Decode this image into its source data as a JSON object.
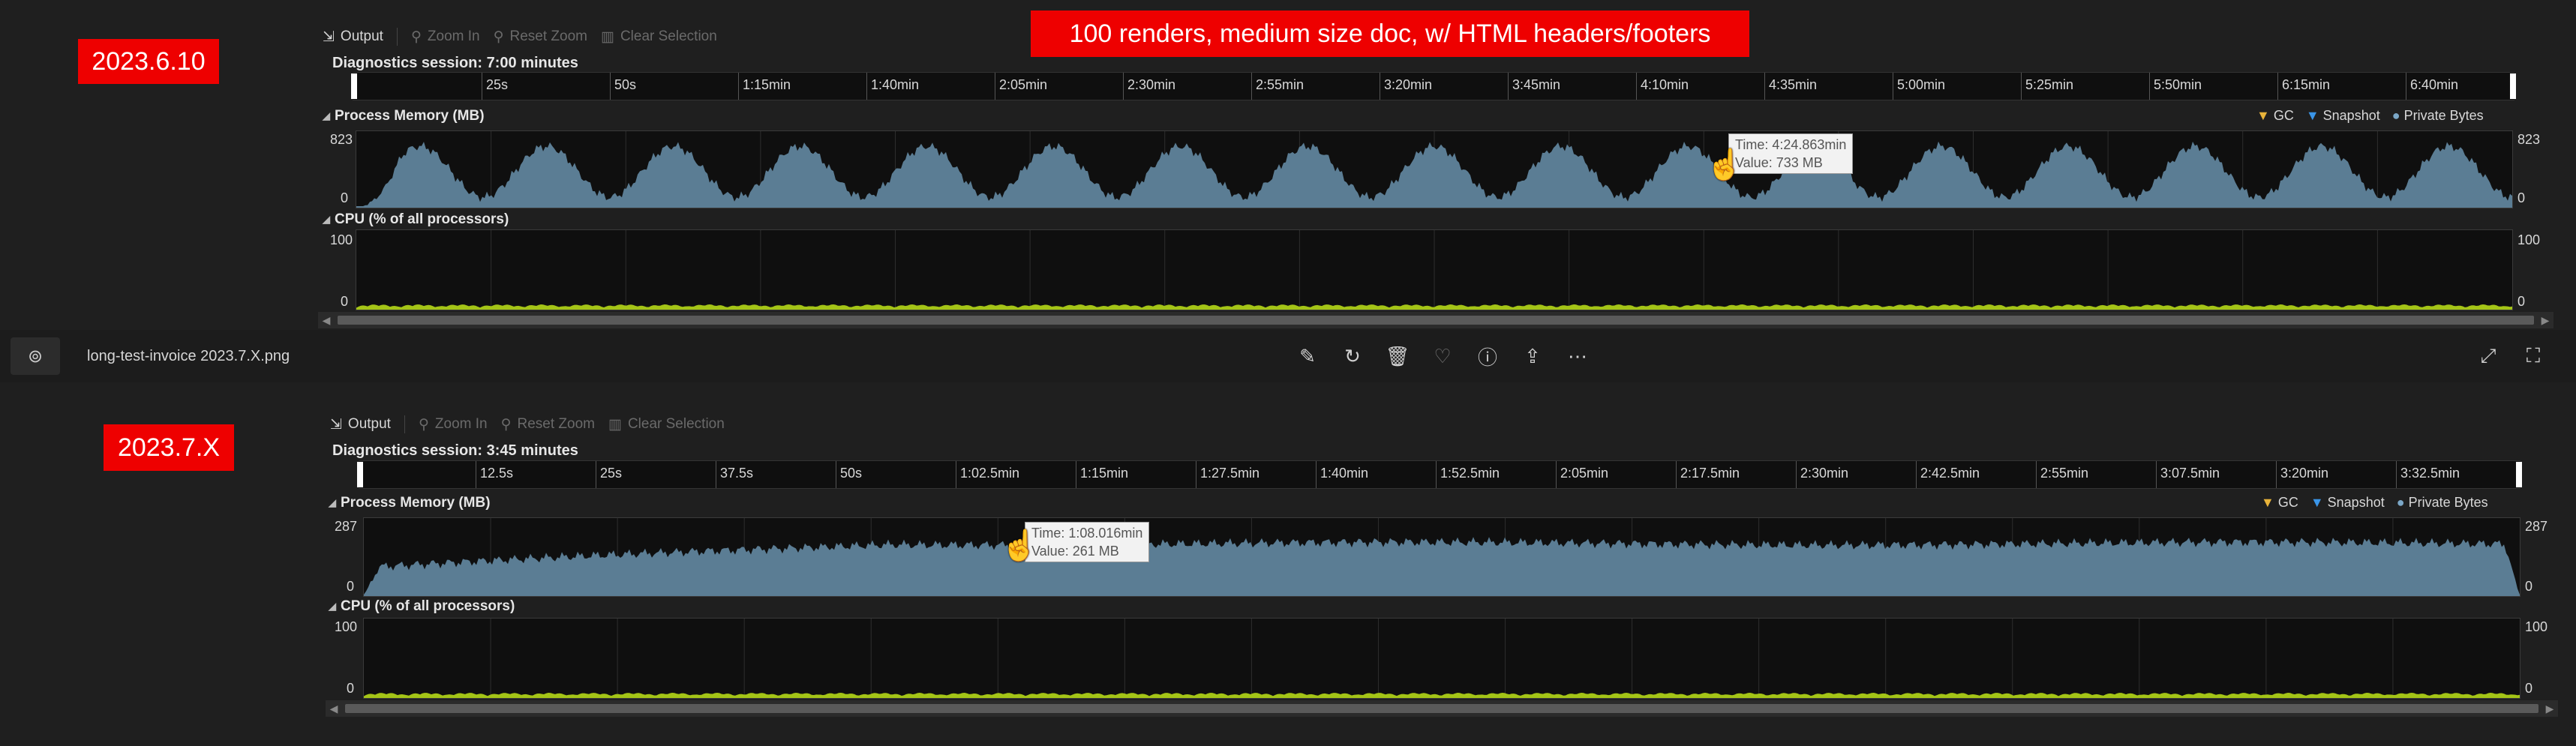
{
  "banner": "100 renders, medium size doc, w/ HTML headers/footers",
  "viewer": {
    "filename": "long-test-invoice 2023.7.X.png",
    "icons": [
      "edit-icon",
      "rotate-icon",
      "delete-icon",
      "favorite-icon",
      "info-icon",
      "share-icon",
      "more-icon",
      "expand-icon",
      "fit-icon"
    ]
  },
  "toolbar": {
    "output": "Output",
    "zoom_in": "Zoom In",
    "reset_zoom": "Reset Zoom",
    "clear_selection": "Clear Selection"
  },
  "legend": {
    "gc": "GC",
    "snapshot": "Snapshot",
    "private_bytes": "Private Bytes"
  },
  "colors": {
    "memory": "#5b7d94",
    "cpu": "#a4c417",
    "banner": "#ee0000",
    "background": "#1f1f1f"
  },
  "top": {
    "label": "2023.6.10",
    "session": "Diagnostics session: 7:00 minutes",
    "ticks": [
      "25s",
      "50s",
      "1:15min",
      "1:40min",
      "2:05min",
      "2:30min",
      "2:55min",
      "3:20min",
      "3:45min",
      "4:10min",
      "4:35min",
      "5:00min",
      "5:25min",
      "5:50min",
      "6:15min",
      "6:40min"
    ],
    "memory_title": "Process Memory (MB)",
    "memory_max": "823",
    "memory_min": "0",
    "cpu_title": "CPU (% of all processors)",
    "cpu_max": "100",
    "cpu_min": "0",
    "tooltip_time": "Time: 4:24.863min",
    "tooltip_value": "Value: 733 MB"
  },
  "bottom": {
    "label": "2023.7.X",
    "session": "Diagnostics session: 3:45 minutes",
    "ticks": [
      "12.5s",
      "25s",
      "37.5s",
      "50s",
      "1:02.5min",
      "1:15min",
      "1:27.5min",
      "1:40min",
      "1:52.5min",
      "2:05min",
      "2:17.5min",
      "2:30min",
      "2:42.5min",
      "2:55min",
      "3:07.5min",
      "3:20min",
      "3:32.5min"
    ],
    "memory_title": "Process Memory (MB)",
    "memory_max": "287",
    "memory_min": "0",
    "cpu_title": "CPU (% of all processors)",
    "cpu_max": "100",
    "cpu_min": "0",
    "tooltip_time": "Time: 1:08.016min",
    "tooltip_value": "Value: 261 MB"
  }
}
